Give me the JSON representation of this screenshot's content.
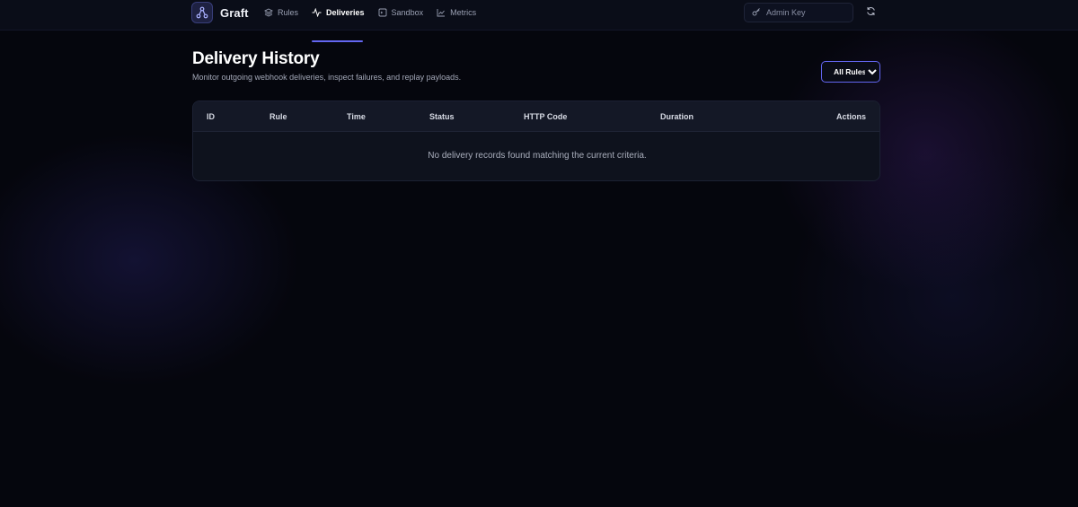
{
  "brand": {
    "name": "Graft",
    "logo_icon": "graph-nodes-icon"
  },
  "nav": [
    {
      "label": "Rules",
      "icon": "layers-icon",
      "active": false
    },
    {
      "label": "Deliveries",
      "icon": "activity-icon",
      "active": true
    },
    {
      "label": "Sandbox",
      "icon": "terminal-box-icon",
      "active": false
    },
    {
      "label": "Metrics",
      "icon": "line-chart-icon",
      "active": false
    }
  ],
  "admin_key": {
    "placeholder": "Admin Key",
    "value": "",
    "icon": "key-icon"
  },
  "refresh": {
    "icon": "refresh-icon"
  },
  "page": {
    "title": "Delivery History",
    "subtitle": "Monitor outgoing webhook deliveries, inspect failures, and replay payloads."
  },
  "filter": {
    "selected": "All Rules",
    "options": [
      "All Rules"
    ]
  },
  "table": {
    "columns": [
      "ID",
      "Rule",
      "Time",
      "Status",
      "HTTP Code",
      "Duration",
      "Actions"
    ],
    "rows": [],
    "empty_message": "No delivery records found matching the current criteria."
  },
  "colors": {
    "accent": "#6366f1",
    "background": "#05060d",
    "card": "#0e121d",
    "header_row": "#141826"
  }
}
